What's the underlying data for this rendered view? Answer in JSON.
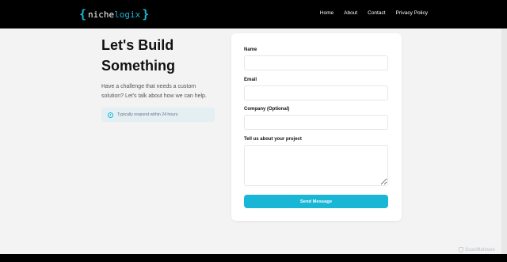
{
  "brand": {
    "name_part1": "niche",
    "name_part2": "logix",
    "open_brace": "{",
    "close_brace": "}",
    "accent": "#19b6d6"
  },
  "nav": {
    "items": [
      "Home",
      "About",
      "Contact",
      "Privacy Policy"
    ]
  },
  "hero": {
    "title_line1": "Let's Build",
    "title_line2": "Something",
    "subtitle": "Have a challenge that needs a custom solution? Let's talk about how we can help."
  },
  "note": {
    "icon": "clock-icon",
    "text": "Typically respond within 24 hours"
  },
  "form": {
    "name_label": "Name",
    "name_value": "",
    "email_label": "Email",
    "email_value": "",
    "company_label": "Company (Optional)",
    "company_value": "",
    "project_label": "Tell us about your project",
    "project_value": "",
    "submit_label": "Send Message"
  },
  "watermark": {
    "text": "ScanMalware"
  }
}
